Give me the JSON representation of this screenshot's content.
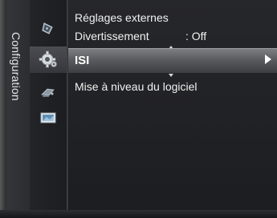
{
  "sidebar": {
    "title": "Configuration"
  },
  "icons": [
    {
      "name": "picture-icon"
    },
    {
      "name": "settings-gear-icon"
    },
    {
      "name": "input-icon"
    },
    {
      "name": "application-icon"
    }
  ],
  "menu": {
    "items": [
      {
        "label": "Réglages externes"
      },
      {
        "label": "Divertissement",
        "value": ": Off"
      },
      {
        "label": "ISI",
        "selected": true
      },
      {
        "label": "Mise à niveau du logiciel"
      }
    ]
  },
  "colors": {
    "selection_bar": "#6b6c70",
    "text": "#f2f2f2",
    "background": "#202124"
  }
}
